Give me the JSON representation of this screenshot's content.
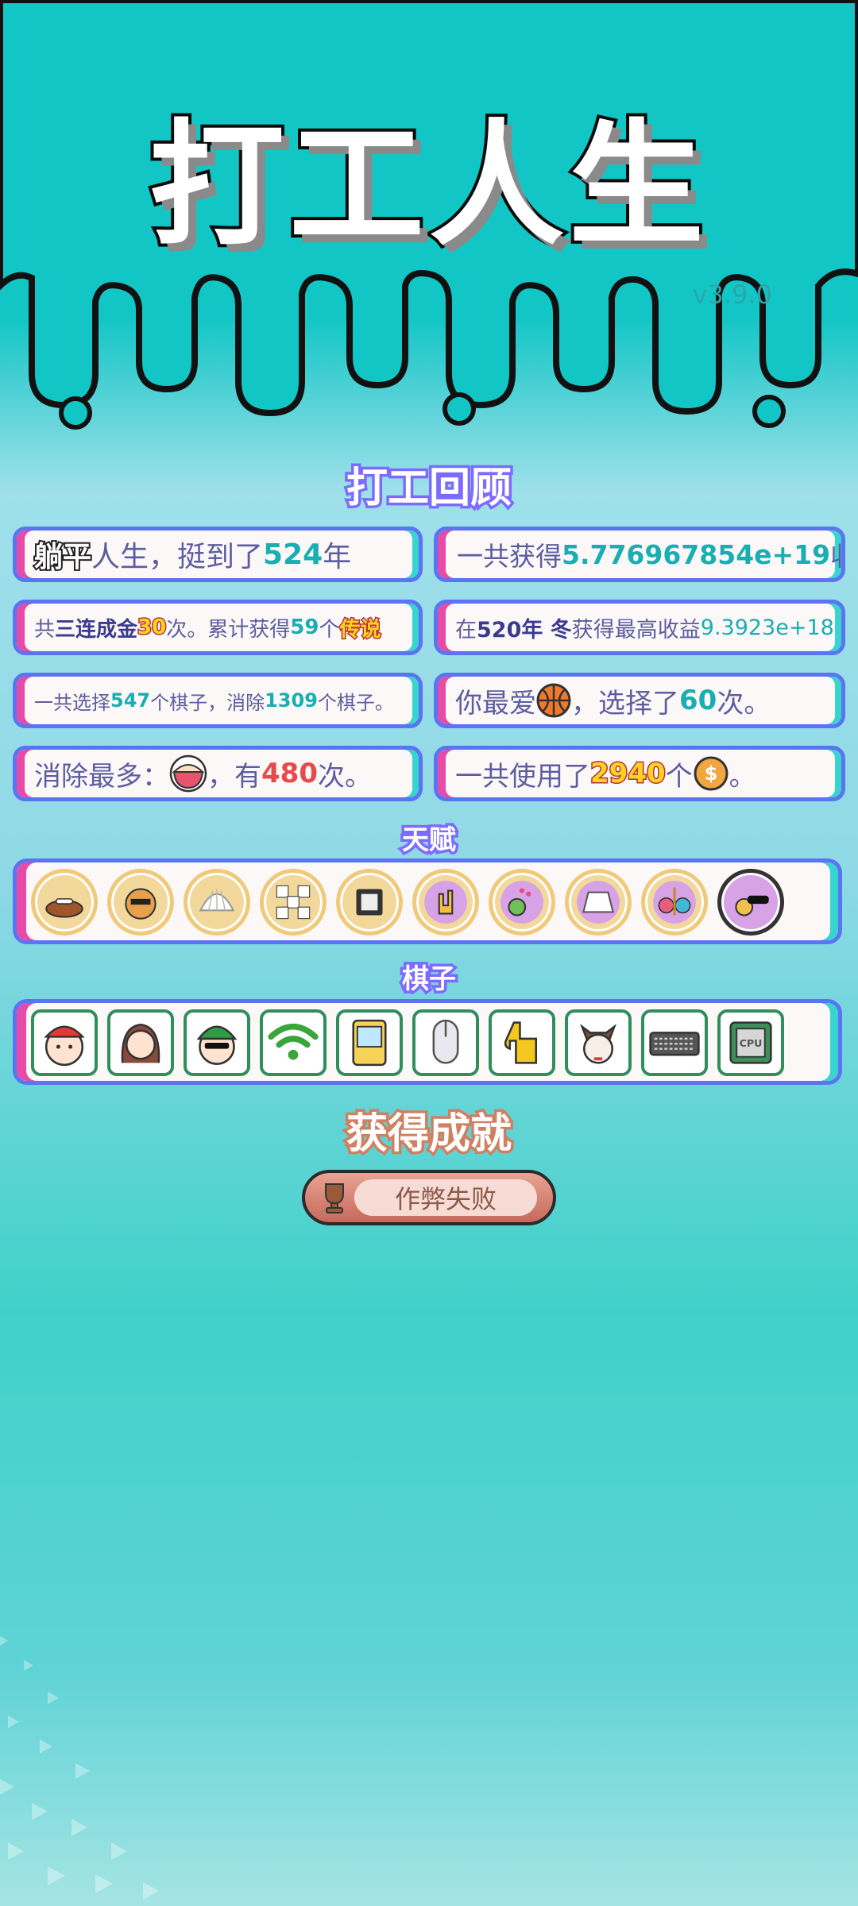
{
  "app": {
    "title": "打工人生",
    "version": "v3.9.0"
  },
  "review": {
    "title": "打工回顾",
    "cards": {
      "c1": {
        "tag": "躺平",
        "text_a": "人生，挺到了",
        "years": "524",
        "text_b": "年"
      },
      "c2": {
        "text_a": "一共获得",
        "total": "5.776967854e+19",
        "text_b": "收益"
      },
      "c3": {
        "text_a": "共",
        "streak_label": "三连成金",
        "streak_count": "30",
        "text_b": "次。累计获得",
        "legend_count": "59",
        "text_c": "个",
        "legend_label": "传说"
      },
      "c4": {
        "text_a": "在 ",
        "year": "520年 冬",
        "text_b": " 获得最高收益",
        "value": "9.3923e+18"
      },
      "c5": {
        "text_a": "一共选择",
        "chosen": "547",
        "text_b": "个棋子，消除",
        "removed": "1309",
        "text_c": "个棋子。"
      },
      "c6": {
        "text_a": "你最爱",
        "favorite_icon": "basketball-icon",
        "text_b": "，选择了",
        "times": "60",
        "text_c": "次。"
      },
      "c7": {
        "text_a": "消除最多：",
        "most_removed_icon": "noodle-bowl-icon",
        "text_b": "，有",
        "count": "480",
        "text_c": "次。"
      },
      "c8": {
        "text_a": "一共使用了",
        "used": "2940",
        "text_b": "个",
        "currency_icon": "dollar-coin-icon",
        "text_c": "。"
      }
    }
  },
  "talents": {
    "title": "天赋",
    "icons": [
      "dog-bowl-icon",
      "shiba-dog-icon",
      "shell-icon",
      "mahjong-tiles-icon",
      "cpu-chip-icon",
      "rock-hand-icon",
      "flower-hat-icon",
      "skirt-icon",
      "gem-scale-icon",
      "sunglasses-icon"
    ]
  },
  "pieces": {
    "title": "棋子",
    "icons": [
      "red-cap-boy-icon",
      "braided-girl-icon",
      "green-hat-man-icon",
      "wifi-icon",
      "claw-machine-icon",
      "mouse-icon",
      "pointing-hand-icon",
      "husky-dog-icon",
      "keyboard-icon",
      "cpu-icon"
    ],
    "cpu_label": "CPU"
  },
  "achievements": {
    "title": "获得成就",
    "button_label": "作弊失败",
    "button_icon": "trophy-icon"
  },
  "colors": {
    "accent_blue": "#5a74f2",
    "accent_pink": "#e84aa8",
    "accent_teal": "#38d4cf",
    "number_teal": "#19aeb3",
    "number_red": "#e84a4a"
  }
}
